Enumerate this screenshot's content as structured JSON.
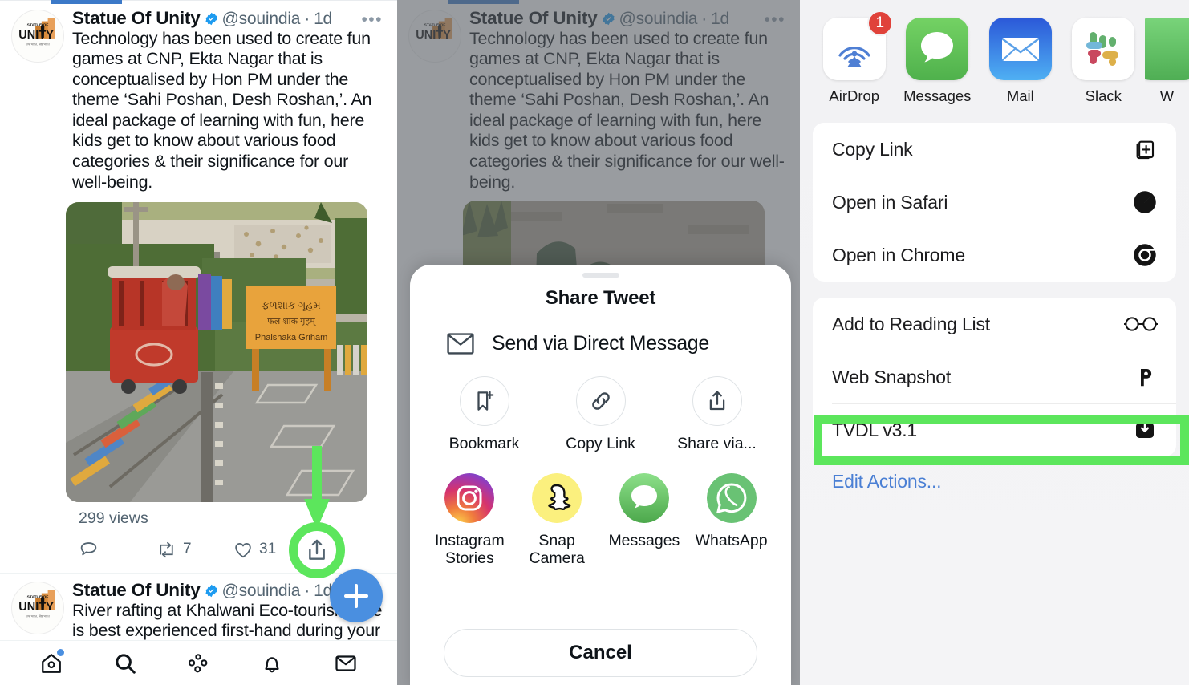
{
  "panel1": {
    "name": "twitter-feed",
    "tweet": {
      "display_name": "Statue Of Unity",
      "handle": "@souindia",
      "time": "1d",
      "separator": "·",
      "more_glyph": "•••",
      "text": "Technology has been used to create fun games at CNP, Ekta Nagar that is conceptualised by Hon PM under the theme ‘Sahi Poshan, Desh Roshan,’. An ideal package of learning with fun, here kids get to know about various food categories & their significance for our well-being.",
      "views": "299 views",
      "actions": [
        {
          "icon": "reply-icon",
          "count": ""
        },
        {
          "icon": "retweet-icon",
          "count": "7"
        },
        {
          "icon": "like-icon",
          "count": "31"
        },
        {
          "icon": "share-icon",
          "count": ""
        }
      ]
    },
    "tweet2": {
      "display_name": "Statue Of Unity",
      "handle": "@souindia",
      "time": "1d",
      "separator": "·",
      "text": "River rafting at Khalwani Eco-tourism Site is best experienced first-hand during your"
    },
    "compose_button_label": "+",
    "bottom_nav": [
      {
        "icon": "home-icon",
        "label": "Home",
        "has_dot": true
      },
      {
        "icon": "search-icon",
        "label": "Search",
        "has_dot": false
      },
      {
        "icon": "spaces-icon",
        "label": "Spaces",
        "has_dot": false
      },
      {
        "icon": "notifications-bell-icon",
        "label": "Notifications",
        "has_dot": false
      },
      {
        "icon": "messages-envelope-icon",
        "label": "Messages",
        "has_dot": false
      }
    ]
  },
  "panel2": {
    "name": "twitter-share-sheet",
    "sheet_title": "Share Tweet",
    "direct_message": {
      "icon": "envelope-icon",
      "label": "Send via Direct Message"
    },
    "actions_row": [
      {
        "icon": "bookmark-plus-icon",
        "label": "Bookmark",
        "highlighted": false
      },
      {
        "icon": "link-icon",
        "label": "Copy Link",
        "highlighted": false
      },
      {
        "icon": "share-up-icon",
        "label": "Share via...",
        "highlighted": true
      }
    ],
    "apps_row": [
      {
        "icon": "instagram-icon",
        "label": "Instagram Stories"
      },
      {
        "icon": "snapchat-icon",
        "label": "Snap Camera"
      },
      {
        "icon": "messages-icon",
        "label": "Messages"
      },
      {
        "icon": "whatsapp-icon",
        "label": "WhatsApp"
      }
    ],
    "cancel_label": "Cancel"
  },
  "panel3": {
    "name": "ios-share-sheet",
    "apps": [
      {
        "icon": "airdrop-icon",
        "label": "AirDrop",
        "badge": "1"
      },
      {
        "icon": "messages-icon",
        "label": "Messages",
        "badge": ""
      },
      {
        "icon": "mail-icon",
        "label": "Mail",
        "badge": ""
      },
      {
        "icon": "slack-icon",
        "label": "Slack",
        "badge": ""
      },
      {
        "icon": "whatsapp-icon",
        "label": "W",
        "badge": ""
      }
    ],
    "group1": [
      {
        "label": "Copy Link",
        "icon": "copy-icon"
      },
      {
        "label": "Open in Safari",
        "icon": "safari-icon"
      },
      {
        "label": "Open in Chrome",
        "icon": "chrome-icon"
      }
    ],
    "group2": [
      {
        "label": "Add to Reading List",
        "icon": "glasses-icon",
        "highlighted": false
      },
      {
        "label": "Web Snapshot",
        "icon": "p-icon",
        "highlighted": false
      },
      {
        "label": "TVDL v3.1",
        "icon": "download-icon",
        "highlighted": true
      }
    ],
    "edit_actions_label": "Edit Actions..."
  },
  "colors": {
    "highlight_green": "#5CE65C",
    "twitter_blue": "#4a8fe0",
    "ios_blue": "#4a7fd4",
    "badge_red": "#e0423a",
    "text_primary": "#0f1419",
    "text_secondary": "#536471"
  }
}
